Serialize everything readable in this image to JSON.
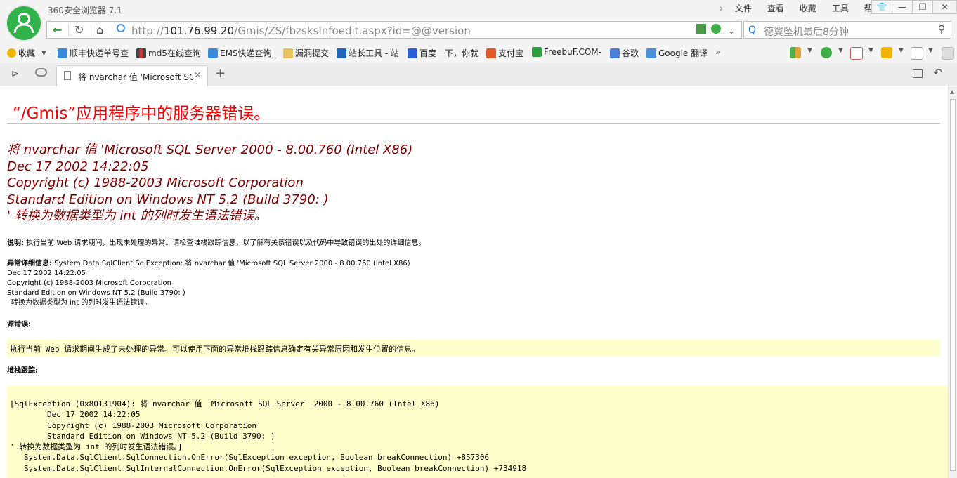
{
  "browser": {
    "app_title": "360安全浏览器 7.1",
    "menu": [
      "文件",
      "查看",
      "收藏",
      "工具",
      "帮助"
    ],
    "url": {
      "base": "http://",
      "host": "101.76.99.20",
      "path": "/Gmis/ZS/fbzsksInfoedit.aspx?id=@@version"
    },
    "search_placeholder": "德翼坠机最后8分钟",
    "favorites": [
      "收藏",
      "顺丰快递单号查",
      "md5在线查询",
      "EMS快递查询_",
      "漏洞提交",
      "站长工具 - 站",
      "百度一下，你就",
      "支付宝",
      "FreebuF.COM-",
      "谷歌",
      "Google 翻译"
    ],
    "tab_title": "将 nvarchar 值 'Microsoft SQ",
    "colors": {
      "logo": "#2fb34a",
      "title_red": "#ff0000",
      "message_maroon": "#800000",
      "code_bg": "#ffffcc"
    }
  },
  "page": {
    "title": "“/Gmis”应用程序中的服务器错误。",
    "message_lines": [
      "将 nvarchar 值 'Microsoft SQL Server  2000 - 8.00.760 (Intel X86)",
      "Dec 17 2002 14:22:05",
      "Copyright (c) 1988-2003 Microsoft Corporation",
      "Standard Edition on Windows NT 5.2 (Build 3790: )",
      "' 转换为数据类型为 int 的列时发生语法错误。"
    ],
    "description_label": "说明:",
    "description_text": "执行当前 Web 请求期间，出现未处理的异常。请检查堆栈跟踪信息，以了解有关该错误以及代码中导致错误的出处的详细信息。",
    "exception_label": "异常详细信息:",
    "exception_lines": [
      "System.Data.SqlClient.SqlException: 将  nvarchar 值  'Microsoft SQL Server  2000 - 8.00.760 (Intel X86)",
      "Dec 17 2002 14:22:05",
      "Copyright (c) 1988-2003 Microsoft Corporation",
      "Standard Edition on Windows NT 5.2 (Build 3790: )",
      "' 转换为数据类型为  int 的列时发生语法错误。"
    ],
    "source_error_label": "源错误:",
    "source_error_text": "执行当前 Web 请求期间生成了未处理的异常。可以使用下面的异常堆栈跟踪信息确定有关异常原因和发生位置的信息。",
    "stack_label": "堆栈跟踪:",
    "stack_trace": "[SqlException (0x80131904): 将 nvarchar 值 'Microsoft SQL Server  2000 - 8.00.760 (Intel X86)\n\tDec 17 2002 14:22:05\n\tCopyright (c) 1988-2003 Microsoft Corporation\n\tStandard Edition on Windows NT 5.2 (Build 3790: )\n' 转换为数据类型为 int 的列时发生语法错误。]\n   System.Data.SqlClient.SqlConnection.OnError(SqlException exception, Boolean breakConnection) +857306\n   System.Data.SqlClient.SqlInternalConnection.OnError(SqlException exception, Boolean breakConnection) +734918"
  }
}
